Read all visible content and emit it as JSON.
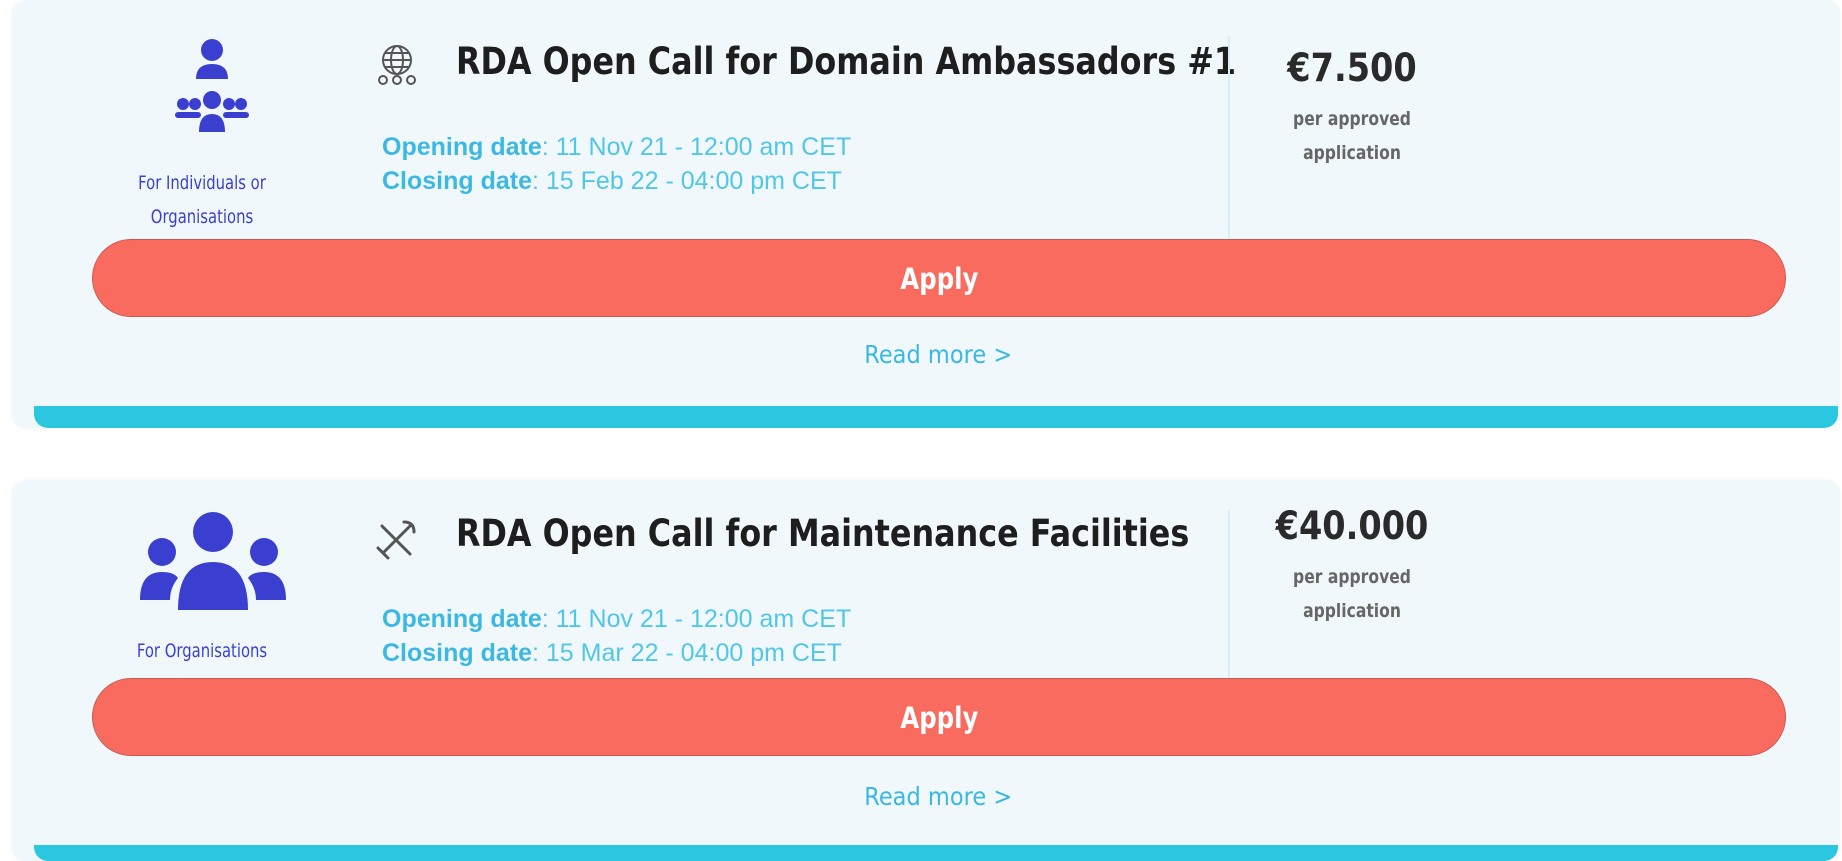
{
  "calls": [
    {
      "audience_icon": "single-person-over-group-icon",
      "audience": "For Individuals or Organisations",
      "title_icon": "globe-network-icon",
      "title": "RDA Open Call for Domain Ambassadors #1",
      "opening_label": "Opening date",
      "opening_value": ": 11 Nov 21 - 12:00 am CET",
      "closing_label": "Closing date",
      "closing_value": ": 15 Feb 22 - 04:00 pm CET",
      "amount": "€7.500",
      "amount_note_line1": "per approved",
      "amount_note_line2": "application",
      "apply_label": "Apply",
      "read_more_label": "Read more >"
    },
    {
      "audience_icon": "group-icon",
      "audience": "For Organisations",
      "title_icon": "tools-icon",
      "title": "RDA Open Call for Maintenance Facilities",
      "opening_label": "Opening date",
      "opening_value": ": 11 Nov 21 - 12:00 am CET",
      "closing_label": "Closing date",
      "closing_value": ": 15 Mar 22 - 04:00 pm CET",
      "amount": "€40.000",
      "amount_note_line1": "per approved",
      "amount_note_line2": "application",
      "apply_label": "Apply",
      "read_more_label": "Read more >"
    }
  ],
  "colors": {
    "card_bg": "#f1f8fb",
    "accent_bar": "#2bc6df",
    "apply_button": "#f96b5f",
    "audience_blue": "#3a3fd0",
    "date_text": "#52c6e6"
  }
}
